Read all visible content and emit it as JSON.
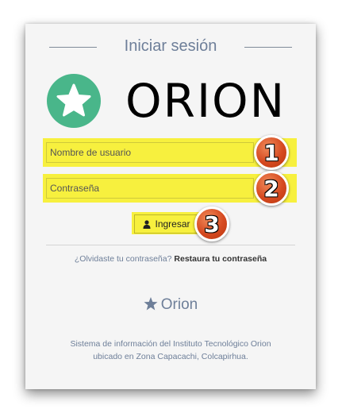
{
  "login": {
    "title": "Iniciar sesión",
    "logo_text": "ORION",
    "username_placeholder": "Nombre de usuario",
    "password_placeholder": "Contraseña",
    "submit_label": "Ingresar",
    "forgot_text": "¿Olvidaste tu contraseña?",
    "restore_link": "Restaura tu contraseña"
  },
  "footer": {
    "brand": "Orion",
    "description_line1": "Sistema de información del Instituto Tecnológico Orion",
    "description_line2": "ubicado en Zona Capacachi, Colcapirhua."
  },
  "annotations": {
    "step1": "1",
    "step2": "2",
    "step3": "3"
  },
  "icons": {
    "logo": "star-icon",
    "submit": "user-icon",
    "brand": "star-icon"
  },
  "colors": {
    "logo_green": "#49b68a",
    "highlight_yellow": "#f7f03e",
    "badge_orange": "#d64a20",
    "muted_text": "#6e7f99"
  }
}
